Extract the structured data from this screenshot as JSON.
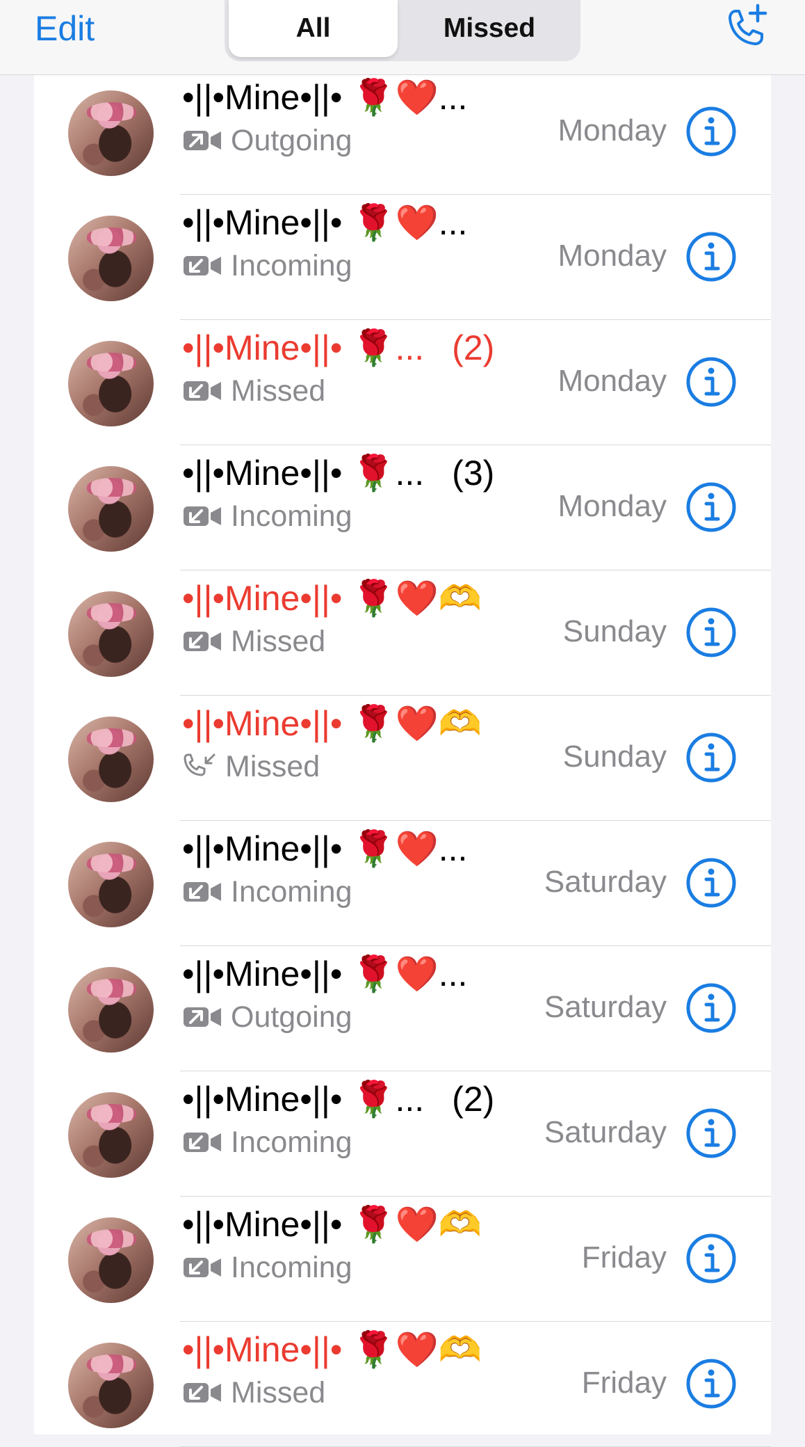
{
  "header": {
    "edit_label": "Edit",
    "tabs": [
      {
        "label": "All",
        "selected": true
      },
      {
        "label": "Missed",
        "selected": false
      }
    ],
    "add_call_icon": "phone-plus-icon"
  },
  "colors": {
    "accent": "#1a7de2",
    "missed": "#eb3b30",
    "secondary_text": "#8a8a8e"
  },
  "calls": [
    {
      "name": "•||•Mine•||• 🌹❤️...",
      "count": "",
      "type": "Outgoing",
      "medium": "video",
      "missed": false,
      "date": "Monday"
    },
    {
      "name": "•||•Mine•||• 🌹❤️...",
      "count": "",
      "type": "Incoming",
      "medium": "video",
      "missed": false,
      "date": "Monday"
    },
    {
      "name": "•||•Mine•||• 🌹...",
      "count": "(2)",
      "type": "Missed",
      "medium": "video",
      "missed": true,
      "date": "Monday"
    },
    {
      "name": "•||•Mine•||• 🌹...",
      "count": "(3)",
      "type": "Incoming",
      "medium": "video",
      "missed": false,
      "date": "Monday"
    },
    {
      "name": "•||•Mine•||• 🌹❤️🫶",
      "count": "",
      "type": "Missed",
      "medium": "video",
      "missed": true,
      "date": "Sunday"
    },
    {
      "name": "•||•Mine•||• 🌹❤️🫶",
      "count": "",
      "type": "Missed",
      "medium": "phone",
      "missed": true,
      "date": "Sunday"
    },
    {
      "name": "•||•Mine•||• 🌹❤️...",
      "count": "",
      "type": "Incoming",
      "medium": "video",
      "missed": false,
      "date": "Saturday"
    },
    {
      "name": "•||•Mine•||• 🌹❤️...",
      "count": "",
      "type": "Outgoing",
      "medium": "video",
      "missed": false,
      "date": "Saturday"
    },
    {
      "name": "•||•Mine•||• 🌹...",
      "count": "(2)",
      "type": "Incoming",
      "medium": "video",
      "missed": false,
      "date": "Saturday"
    },
    {
      "name": "•||•Mine•||• 🌹❤️🫶",
      "count": "",
      "type": "Incoming",
      "medium": "video",
      "missed": false,
      "date": "Friday"
    },
    {
      "name": "•||•Mine•||• 🌹❤️🫶",
      "count": "",
      "type": "Missed",
      "medium": "video",
      "missed": true,
      "date": "Friday"
    }
  ]
}
